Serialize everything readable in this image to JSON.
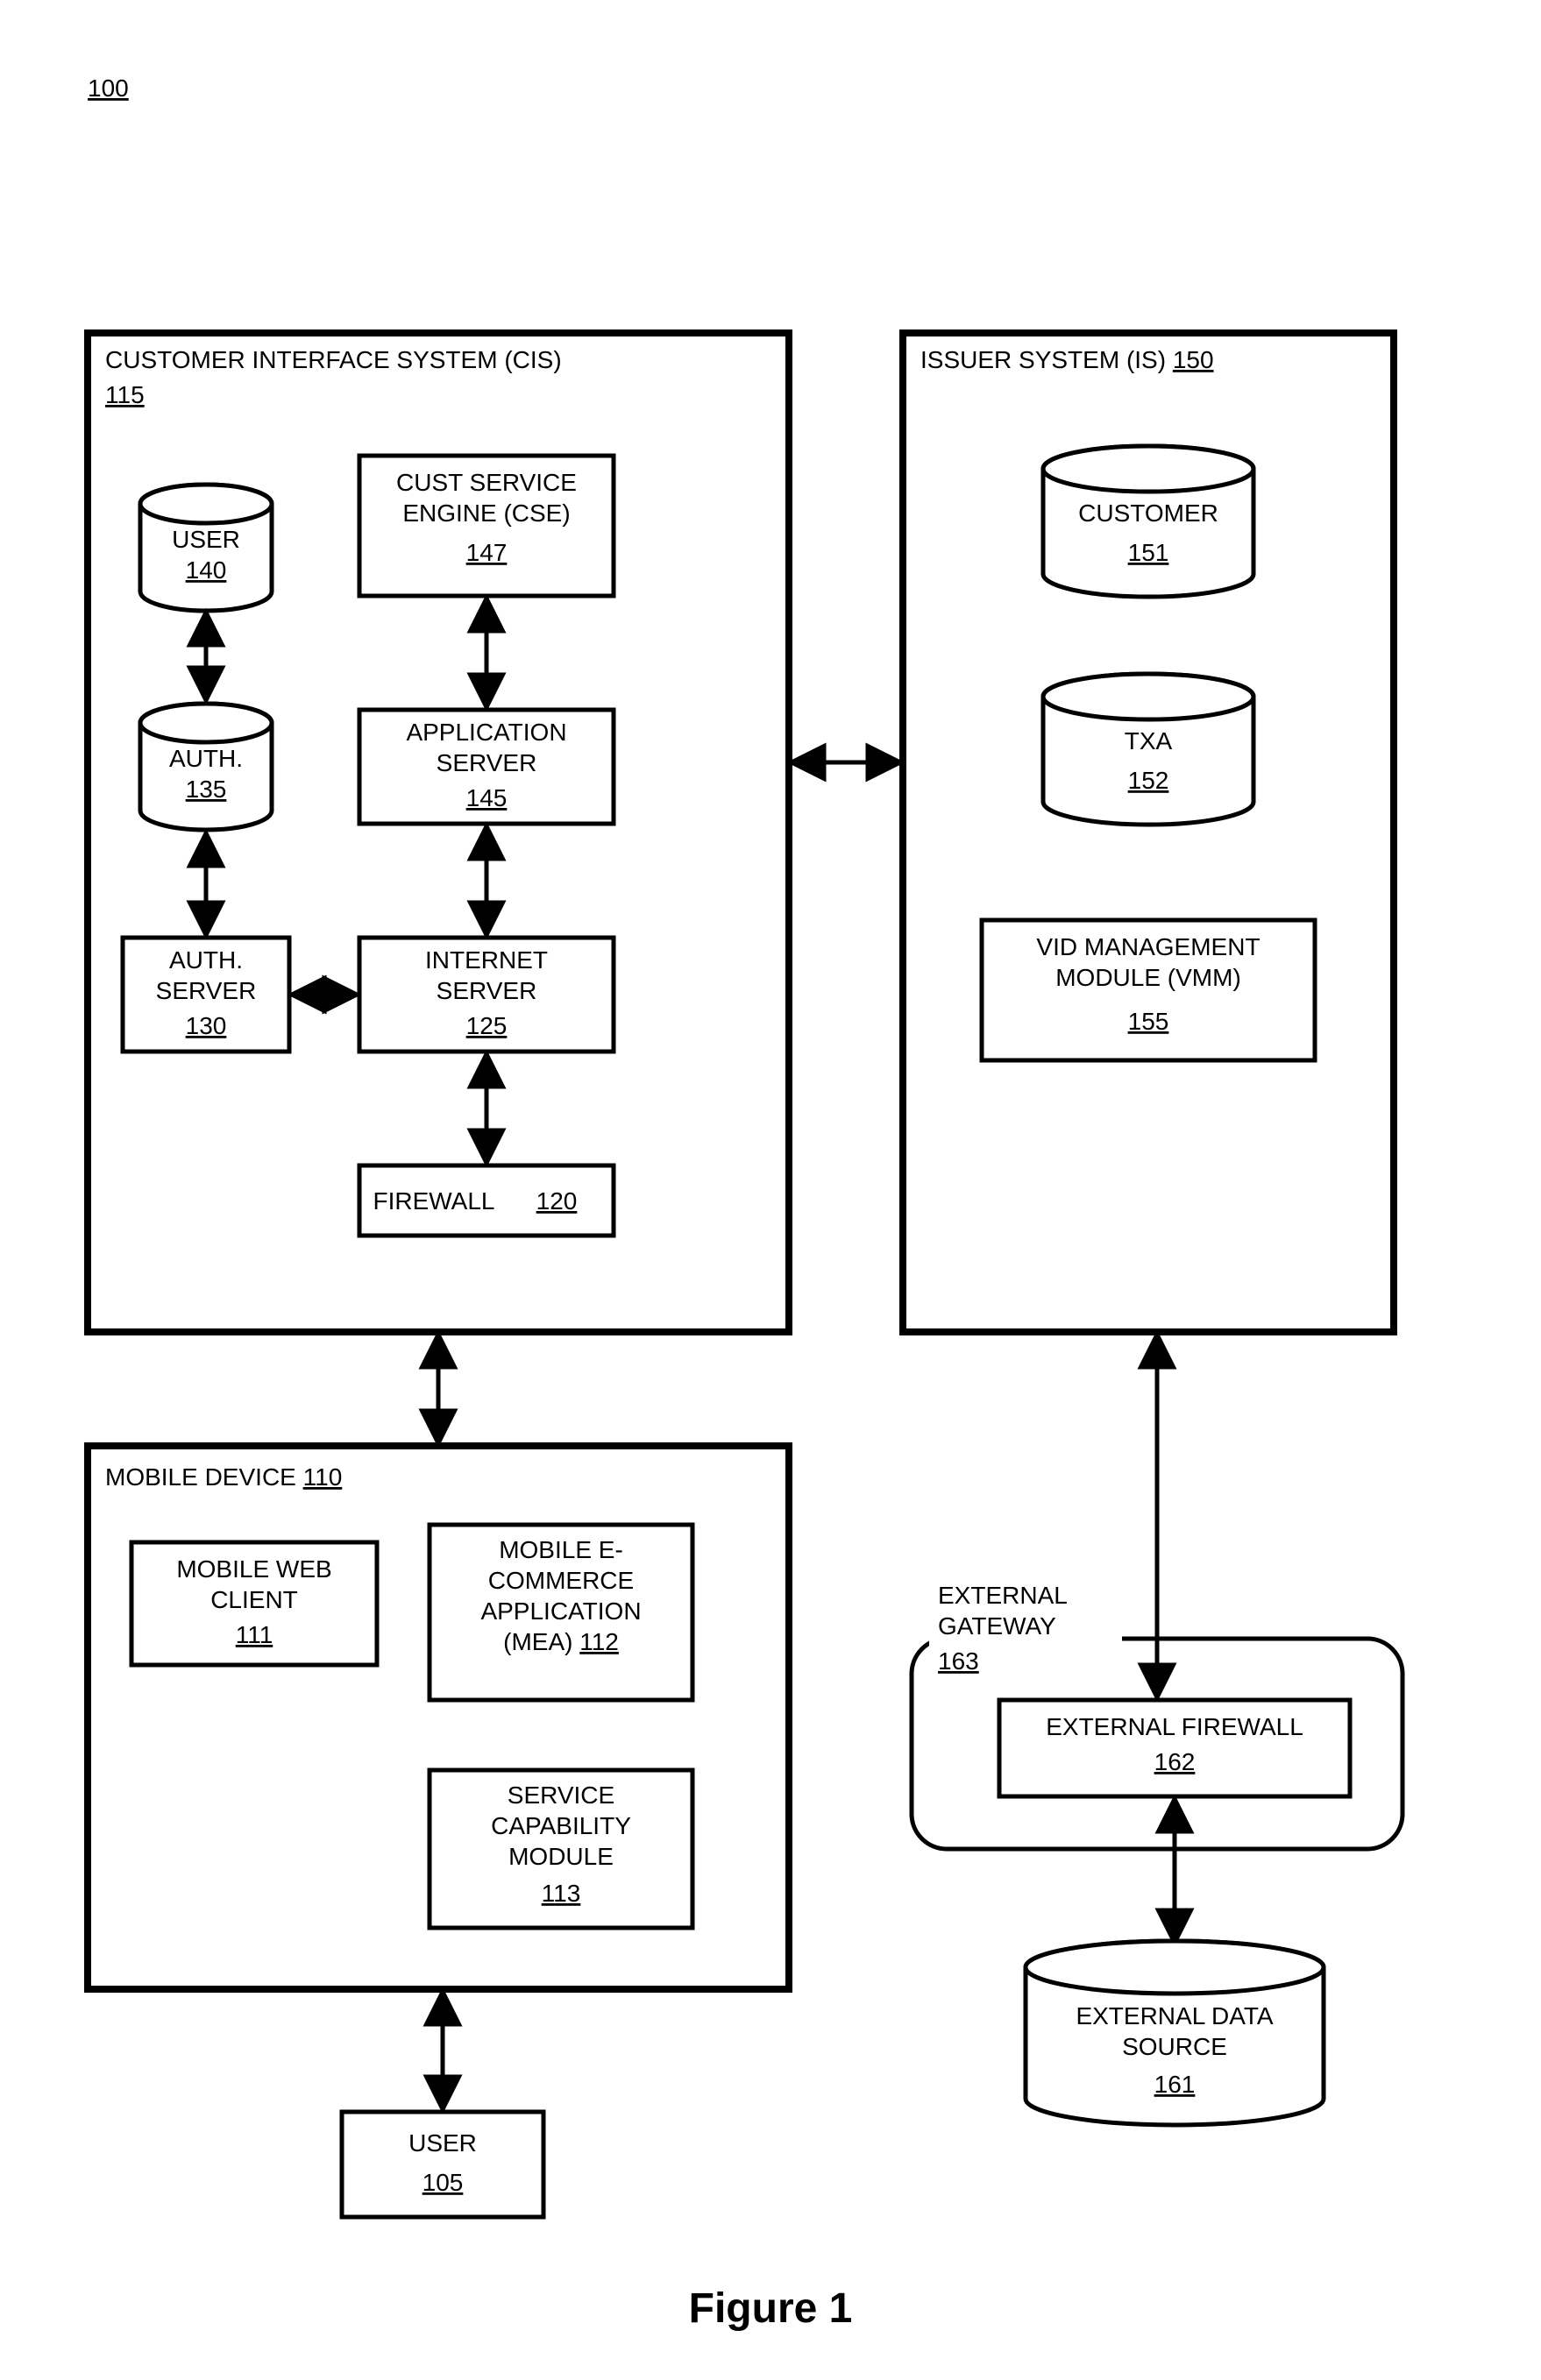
{
  "figure": {
    "overall_ref": "100",
    "caption": "Figure 1"
  },
  "cis": {
    "title": "CUSTOMER INTERFACE SYSTEM (CIS)",
    "ref": "115",
    "user_db": {
      "label": "USER",
      "ref": "140"
    },
    "auth_db": {
      "label": "AUTH.",
      "ref": "135"
    },
    "auth_server": {
      "label": "AUTH. SERVER",
      "ref": "130"
    },
    "cse": {
      "label1": "CUST SERVICE",
      "label2": "ENGINE (CSE)",
      "ref": "147"
    },
    "app_server": {
      "label1": "APPLICATION",
      "label2": "SERVER",
      "ref": "145"
    },
    "internet_server": {
      "label1": "INTERNET",
      "label2": "SERVER",
      "ref": "125"
    },
    "firewall": {
      "label": "FIREWALL",
      "ref": "120"
    }
  },
  "is": {
    "title": "ISSUER SYSTEM (IS)",
    "ref": "150",
    "customer_db": {
      "label": "CUSTOMER",
      "ref": "151"
    },
    "txa_db": {
      "label": "TXA",
      "ref": "152"
    },
    "vmm": {
      "label1": "VID MANAGEMENT",
      "label2": "MODULE (VMM)",
      "ref": "155"
    }
  },
  "mobile": {
    "title": "MOBILE DEVICE",
    "ref": "110",
    "web_client": {
      "label1": "MOBILE WEB",
      "label2": "CLIENT",
      "ref": "111"
    },
    "mea": {
      "label1": "MOBILE E-",
      "label2": "COMMERCE",
      "label3": "APPLICATION",
      "label4": "(MEA)",
      "ref": "112"
    },
    "scm": {
      "label1": "SERVICE",
      "label2": "CAPABILITY",
      "label3": "MODULE",
      "ref": "113"
    }
  },
  "user_box": {
    "label": "USER",
    "ref": "105"
  },
  "ext_gateway": {
    "title": "EXTERNAL GATEWAY",
    "ref": "163",
    "firewall": {
      "label": "EXTERNAL FIREWALL",
      "ref": "162"
    },
    "data_source": {
      "label1": "EXTERNAL DATA",
      "label2": "SOURCE",
      "ref": "161"
    }
  }
}
